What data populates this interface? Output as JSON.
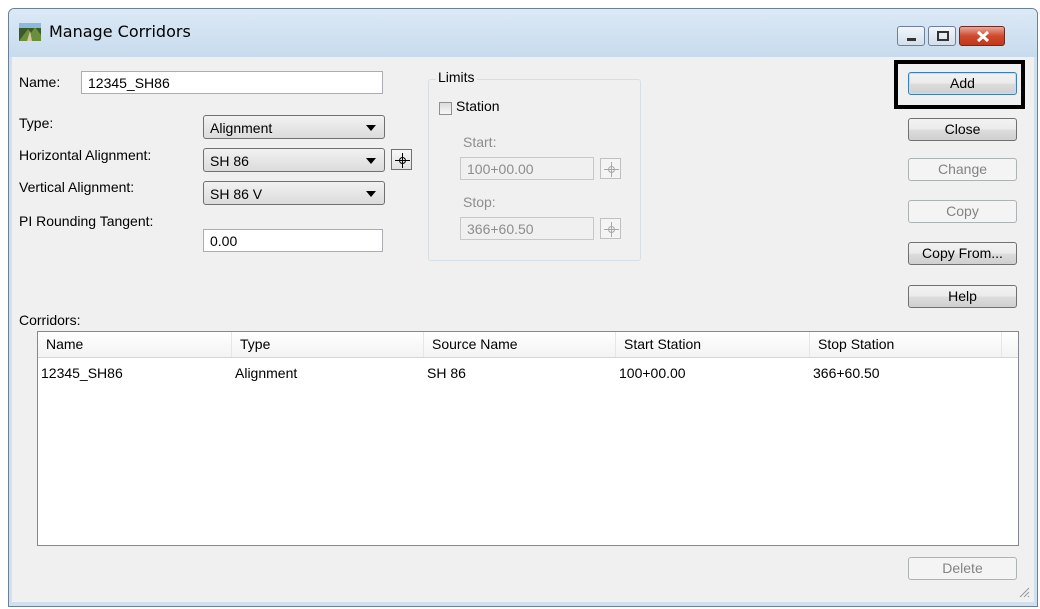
{
  "window": {
    "title": "Manage Corridors",
    "icon": "corridor-app-icon",
    "controls": [
      "minimize-icon",
      "maximize-icon",
      "close-icon"
    ],
    "accent_close": "#c23818"
  },
  "form": {
    "name_label": "Name:",
    "name_value": "12345_SH86",
    "type_label": "Type:",
    "type_value": "Alignment",
    "horizontal_label": "Horizontal Alignment:",
    "horizontal_value": "SH 86",
    "vertical_label": "Vertical Alignment:",
    "vertical_value": "SH 86 V",
    "pi_label": "PI Rounding Tangent:",
    "pi_value": "0.00"
  },
  "limits": {
    "group_label": "Limits",
    "station_label": "Station",
    "station_checked": false,
    "start_label": "Start:",
    "start_value": "100+00.00",
    "stop_label": "Stop:",
    "stop_value": "366+60.50"
  },
  "buttons": {
    "add": "Add",
    "close": "Close",
    "change": "Change",
    "copy": "Copy",
    "copy_from": "Copy From...",
    "help": "Help",
    "delete": "Delete"
  },
  "corridors": {
    "label": "Corridors:",
    "columns": [
      "Name",
      "Type",
      "Source Name",
      "Start Station",
      "Stop Station"
    ],
    "rows": [
      [
        "12345_SH86",
        "Alignment",
        "SH 86",
        "100+00.00",
        "366+60.50"
      ]
    ]
  }
}
